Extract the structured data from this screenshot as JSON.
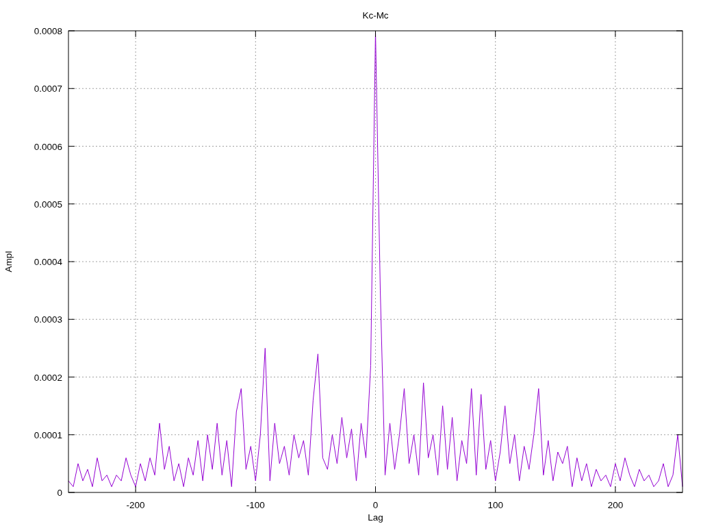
{
  "chart_data": {
    "type": "line",
    "grid": true,
    "title": "Kc-Mc",
    "xlabel": "Lag",
    "ylabel": "Ampl",
    "xlim": [
      -256,
      256
    ],
    "ylim": [
      0,
      0.0008
    ],
    "xticks": [
      -200,
      -100,
      0,
      100,
      200
    ],
    "yticks": [
      {
        "value": 0,
        "label": "0"
      },
      {
        "value": 0.0001,
        "label": "0.0001"
      },
      {
        "value": 0.0002,
        "label": "0.0002"
      },
      {
        "value": 0.0003,
        "label": "0.0003"
      },
      {
        "value": 0.0004,
        "label": "0.0004"
      },
      {
        "value": 0.0005,
        "label": "0.0005"
      },
      {
        "value": 0.0006,
        "label": "0.0006"
      },
      {
        "value": 0.0007,
        "label": "0.0007"
      },
      {
        "value": 0.0008,
        "label": "0.0008"
      }
    ],
    "x": [
      -256,
      -252,
      -248,
      -244,
      -240,
      -236,
      -232,
      -228,
      -224,
      -220,
      -216,
      -212,
      -208,
      -204,
      -200,
      -196,
      -192,
      -188,
      -184,
      -180,
      -176,
      -172,
      -168,
      -164,
      -160,
      -156,
      -152,
      -148,
      -144,
      -140,
      -136,
      -132,
      -128,
      -124,
      -120,
      -116,
      -112,
      -108,
      -104,
      -100,
      -96,
      -92,
      -88,
      -84,
      -80,
      -76,
      -72,
      -68,
      -64,
      -60,
      -56,
      -52,
      -48,
      -44,
      -40,
      -36,
      -32,
      -28,
      -24,
      -20,
      -16,
      -12,
      -8,
      -4,
      0,
      4,
      8,
      12,
      16,
      20,
      24,
      28,
      32,
      36,
      40,
      44,
      48,
      52,
      56,
      60,
      64,
      68,
      72,
      76,
      80,
      84,
      88,
      92,
      96,
      100,
      104,
      108,
      112,
      116,
      120,
      124,
      128,
      132,
      136,
      140,
      144,
      148,
      152,
      156,
      160,
      164,
      168,
      172,
      176,
      180,
      184,
      188,
      192,
      196,
      200,
      204,
      208,
      212,
      216,
      220,
      224,
      228,
      232,
      236,
      240,
      244,
      248,
      252,
      256
    ],
    "series": [
      {
        "color": "#9400d3",
        "values": [
          2e-05,
          1e-05,
          5e-05,
          2e-05,
          4e-05,
          1e-05,
          6e-05,
          2e-05,
          3e-05,
          1e-05,
          3e-05,
          2e-05,
          6e-05,
          3e-05,
          1e-05,
          5e-05,
          2e-05,
          6e-05,
          3e-05,
          0.00012,
          4e-05,
          8e-05,
          2e-05,
          5e-05,
          1e-05,
          6e-05,
          3e-05,
          9e-05,
          2e-05,
          0.0001,
          4e-05,
          0.00012,
          3e-05,
          9e-05,
          1e-05,
          0.00014,
          0.00018,
          4e-05,
          8e-05,
          2e-05,
          0.0001,
          0.00025,
          2e-05,
          0.00012,
          5e-05,
          8e-05,
          3e-05,
          0.0001,
          6e-05,
          9e-05,
          3e-05,
          0.00016,
          0.00024,
          6e-05,
          4e-05,
          0.0001,
          5e-05,
          0.00013,
          6e-05,
          0.00011,
          2e-05,
          0.00012,
          6e-05,
          0.00022,
          0.0008,
          0.00035,
          3e-05,
          0.00012,
          4e-05,
          0.0001,
          0.00018,
          5e-05,
          0.0001,
          3e-05,
          0.00019,
          6e-05,
          0.0001,
          3e-05,
          0.00015,
          4e-05,
          0.00013,
          2e-05,
          9e-05,
          5e-05,
          0.00018,
          3e-05,
          0.00017,
          4e-05,
          9e-05,
          2e-05,
          7e-05,
          0.00015,
          5e-05,
          0.0001,
          2e-05,
          8e-05,
          4e-05,
          0.0001,
          0.00018,
          3e-05,
          9e-05,
          2e-05,
          7e-05,
          5e-05,
          8e-05,
          1e-05,
          6e-05,
          2e-05,
          5e-05,
          1e-05,
          4e-05,
          2e-05,
          3e-05,
          1e-05,
          5e-05,
          2e-05,
          6e-05,
          3e-05,
          1e-05,
          4e-05,
          2e-05,
          3e-05,
          1e-05,
          2e-05,
          5e-05,
          1e-05,
          3e-05,
          0.0001,
          1e-05
        ]
      }
    ]
  }
}
